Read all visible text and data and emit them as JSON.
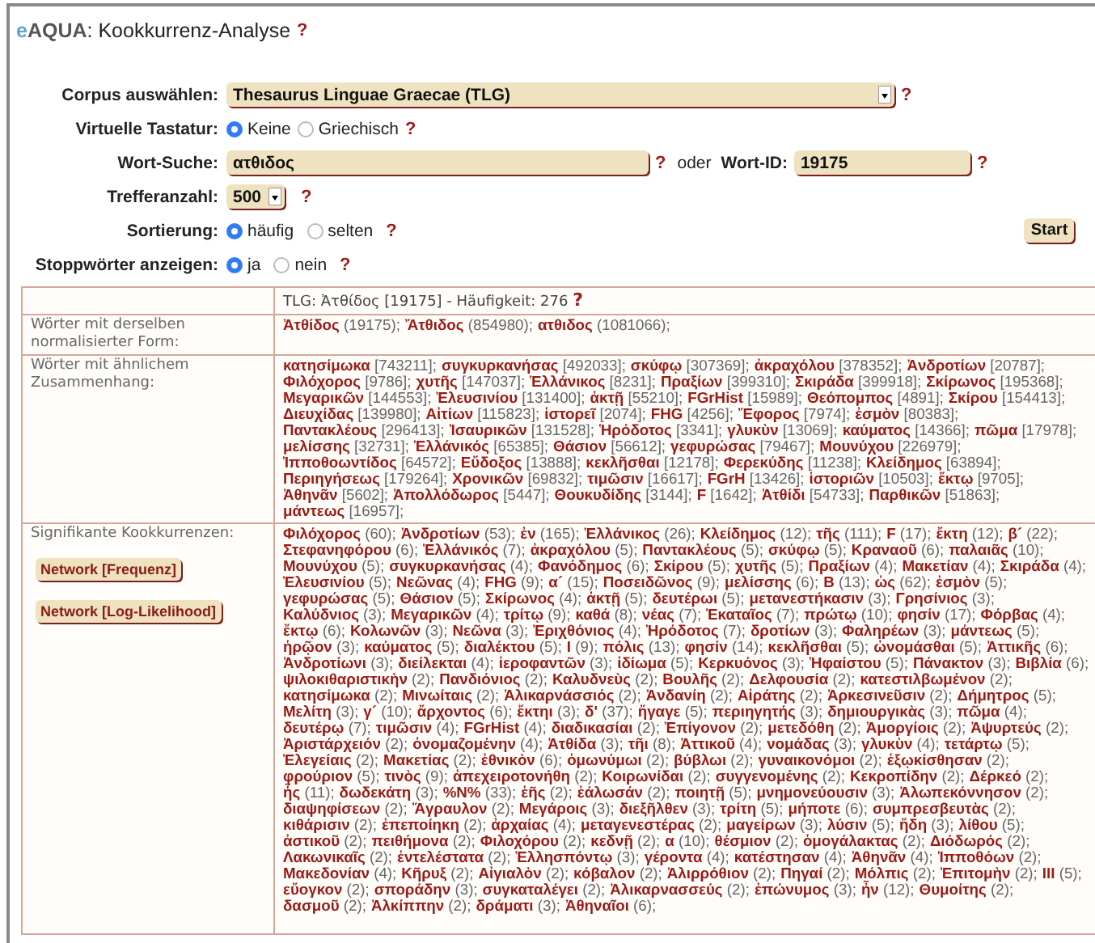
{
  "title": {
    "logo_e": "e",
    "logo_aqua": "AQUA",
    "text": ": Kookkurrenz-Analyse",
    "help": "?"
  },
  "form": {
    "corpus": {
      "label": "Corpus auswählen:",
      "value": "Thesaurus Linguae Graecae (TLG)",
      "help": "?"
    },
    "keyboard": {
      "label": "Virtuelle Tastatur:",
      "options": [
        {
          "label": "Keine",
          "selected": true
        },
        {
          "label": "Griechisch",
          "selected": false
        }
      ],
      "help": "?"
    },
    "search": {
      "label": "Wort-Suche:",
      "value": "ατθιδος",
      "help": "?",
      "or_text": "oder",
      "id_label": "Wort-ID:",
      "id_value": "19175",
      "id_help": "?"
    },
    "hits": {
      "label": "Trefferanzahl:",
      "value": "500",
      "help": "?"
    },
    "sort": {
      "label": "Sortierung:",
      "options": [
        {
          "label": "häufig",
          "selected": true
        },
        {
          "label": "selten",
          "selected": false
        }
      ],
      "help": "?"
    },
    "stopwords": {
      "label": "Stoppwörter anzeigen:",
      "options": [
        {
          "label": "ja",
          "selected": true
        },
        {
          "label": "nein",
          "selected": false
        }
      ],
      "help": "?"
    },
    "start_button": "Start"
  },
  "results": {
    "header": {
      "text": "TLG: Ἀτθίδος [19175] - Häufigkeit: 276",
      "help": "?"
    },
    "same_form": {
      "label": "Wörter mit derselben normalisierter Form:",
      "words": [
        {
          "word": "Ἀτθίδος",
          "count": "(19175);"
        },
        {
          "word": "Ἄτθιδος",
          "count": "(854980);"
        },
        {
          "word": "ατθιδος",
          "count": "(1081066);"
        }
      ]
    },
    "similar": {
      "label": "Wörter mit ähnlichem Zusammenhang:",
      "words": [
        {
          "word": "κατησίμωκα",
          "count": "[743211];"
        },
        {
          "word": "συγκυρκανήσας",
          "count": "[492033];"
        },
        {
          "word": "σκύφῳ",
          "count": "[307369];"
        },
        {
          "word": "ἀκραχόλου",
          "count": "[378352];"
        },
        {
          "word": "Ἀνδροτίων",
          "count": "[20787];"
        },
        {
          "word": "Φιλόχορος",
          "count": "[9786];"
        },
        {
          "word": "χυτῆς",
          "count": "[147037];"
        },
        {
          "word": "Ἑλλάνικος",
          "count": "[8231];"
        },
        {
          "word": "Πραξίων",
          "count": "[399310];"
        },
        {
          "word": "Σκιράδα",
          "count": "[399918];"
        },
        {
          "word": "Σκίρωνος",
          "count": "[195368];"
        },
        {
          "word": "Μεγαρικῶν",
          "count": "[144553];"
        },
        {
          "word": "Ἐλευσινίου",
          "count": "[131400];"
        },
        {
          "word": "ἀκτῇ",
          "count": "[55210];"
        },
        {
          "word": "FGrHist",
          "count": "[15989];"
        },
        {
          "word": "Θεόπομπος",
          "count": "[4891];"
        },
        {
          "word": "Σκίρου",
          "count": "[154413];"
        },
        {
          "word": "Διευχίδας",
          "count": "[139980];"
        },
        {
          "word": "Αἰτίων",
          "count": "[115823];"
        },
        {
          "word": "ἱστορεῖ",
          "count": "[2074];"
        },
        {
          "word": "FHG",
          "count": "[4256];"
        },
        {
          "word": "Ἔφορος",
          "count": "[7974];"
        },
        {
          "word": "ἐσμὸν",
          "count": "[80383];"
        },
        {
          "word": "Παντακλέους",
          "count": "[296413];"
        },
        {
          "word": "Ἰσαυρικῶν",
          "count": "[131528];"
        },
        {
          "word": "Ἡρόδοτος",
          "count": "[3341];"
        },
        {
          "word": "γλυκὺν",
          "count": "[13069];"
        },
        {
          "word": "καύματος",
          "count": "[14366];"
        },
        {
          "word": "πῶμα",
          "count": "[17978];"
        },
        {
          "word": "μελίσσης",
          "count": "[32731];"
        },
        {
          "word": "Ἑλλάνικός",
          "count": "[65385];"
        },
        {
          "word": "Θάσιον",
          "count": "[56612];"
        },
        {
          "word": "γεφυρώσας",
          "count": "[79467];"
        },
        {
          "word": "Μουνύχου",
          "count": "[226979];"
        },
        {
          "word": "Ἱπποθοωντίδος",
          "count": "[64572];"
        },
        {
          "word": "Εὔδοξος",
          "count": "[13888];"
        },
        {
          "word": "κεκλῆσθαι",
          "count": "[12178];"
        },
        {
          "word": "Φερεκύδης",
          "count": "[11238];"
        },
        {
          "word": "Κλείδημος",
          "count": "[63894];"
        },
        {
          "word": "Περιηγήσεως",
          "count": "[179264];"
        },
        {
          "word": "Χρονικῶν",
          "count": "[69832];"
        },
        {
          "word": "τιμῶσιν",
          "count": "[16617];"
        },
        {
          "word": "FGrH",
          "count": "[13426];"
        },
        {
          "word": "ἱστοριῶν",
          "count": "[10503];"
        },
        {
          "word": "ἔκτῳ",
          "count": "[9705];"
        },
        {
          "word": "Ἀθηνᾶν",
          "count": "[5602];"
        },
        {
          "word": "Ἀπολλόδωρος",
          "count": "[5447];"
        },
        {
          "word": "Θουκυδίδης",
          "count": "[3144];"
        },
        {
          "word": "F",
          "count": "[1642];"
        },
        {
          "word": "Ἀτθίδι",
          "count": "[54733];"
        },
        {
          "word": "Παρθικῶν",
          "count": "[51863];"
        },
        {
          "word": "μάντεως",
          "count": "[16957];"
        }
      ]
    },
    "cooccurrences": {
      "label": "Signifikante Kookkurrenzen:",
      "buttons": [
        "Network [Frequenz]",
        "Network [Log-Likelihood]"
      ],
      "words": [
        {
          "word": "Φιλόχορος",
          "count": "(60);"
        },
        {
          "word": "Ἀνδροτίων",
          "count": "(53);"
        },
        {
          "word": "ἐν",
          "count": "(165);"
        },
        {
          "word": "Ἑλλάνικος",
          "count": "(26);"
        },
        {
          "word": "Κλείδημος",
          "count": "(12);"
        },
        {
          "word": "τῆς",
          "count": "(111);"
        },
        {
          "word": "F",
          "count": "(17);"
        },
        {
          "word": "ἔκτη",
          "count": "(12);"
        },
        {
          "word": "β´",
          "count": "(22);"
        },
        {
          "word": "Στεφανηφόρου",
          "count": "(6);"
        },
        {
          "word": "Ἑλλάνικός",
          "count": "(7);"
        },
        {
          "word": "ἀκραχόλου",
          "count": "(5);"
        },
        {
          "word": "Παντακλέους",
          "count": "(5);"
        },
        {
          "word": "σκύφῳ",
          "count": "(5);"
        },
        {
          "word": "Κραναοῦ",
          "count": "(6);"
        },
        {
          "word": "παλαιᾶς",
          "count": "(10);"
        },
        {
          "word": "Μουνύχου",
          "count": "(5);"
        },
        {
          "word": "συγκυρκανήσας",
          "count": "(4);"
        },
        {
          "word": "Φανόδημος",
          "count": "(6);"
        },
        {
          "word": "Σκίρου",
          "count": "(5);"
        },
        {
          "word": "χυτῆς",
          "count": "(5);"
        },
        {
          "word": "Πραξίων",
          "count": "(4);"
        },
        {
          "word": "Μακετίαν",
          "count": "(4);"
        },
        {
          "word": "Σκιράδα",
          "count": "(4);"
        },
        {
          "word": "Ἐλευσινίου",
          "count": "(5);"
        },
        {
          "word": "Νεῶνας",
          "count": "(4);"
        },
        {
          "word": "FHG",
          "count": "(9);"
        },
        {
          "word": "α´",
          "count": "(15);"
        },
        {
          "word": "Ποσειδῶνος",
          "count": "(9);"
        },
        {
          "word": "μελίσσης",
          "count": "(6);"
        },
        {
          "word": "Β",
          "count": "(13);"
        },
        {
          "word": "ὡς",
          "count": "(62);"
        },
        {
          "word": "ἐσμὸν",
          "count": "(5);"
        },
        {
          "word": "γεφυρώσας",
          "count": "(5);"
        },
        {
          "word": "Θάσιον",
          "count": "(5);"
        },
        {
          "word": "Σκίρωνος",
          "count": "(4);"
        },
        {
          "word": "ἀκτῇ",
          "count": "(5);"
        },
        {
          "word": "δευτέρωι",
          "count": "(5);"
        },
        {
          "word": "μετανεστήκασιν",
          "count": "(3);"
        },
        {
          "word": "Γρησίνιος",
          "count": "(3);"
        },
        {
          "word": "Καλύδνιος",
          "count": "(3);"
        },
        {
          "word": "Μεγαρικῶν",
          "count": "(4);"
        },
        {
          "word": "τρίτῳ",
          "count": "(9);"
        },
        {
          "word": "καθά",
          "count": "(8);"
        },
        {
          "word": "νέας",
          "count": "(7);"
        },
        {
          "word": "Ἑκαταῖος",
          "count": "(7);"
        },
        {
          "word": "πρώτῳ",
          "count": "(10);"
        },
        {
          "word": "φησίν",
          "count": "(17);"
        },
        {
          "word": "Φόρβας",
          "count": "(4);"
        },
        {
          "word": "ἔκτῳ",
          "count": "(6);"
        },
        {
          "word": "Κολωνῶν",
          "count": "(3);"
        },
        {
          "word": "Νεῶνα",
          "count": "(3);"
        },
        {
          "word": "Ἐριχθόνιος",
          "count": "(4);"
        },
        {
          "word": "Ἡρόδοτος",
          "count": "(7);"
        },
        {
          "word": "δροτίων",
          "count": "(3);"
        },
        {
          "word": "Φαληρέων",
          "count": "(3);"
        },
        {
          "word": "μάντεως",
          "count": "(5);"
        },
        {
          "word": "ἡρῷον",
          "count": "(3);"
        },
        {
          "word": "καύματος",
          "count": "(5);"
        },
        {
          "word": "διαλέκτου",
          "count": "(5);"
        },
        {
          "word": "I",
          "count": "(9);"
        },
        {
          "word": "πόλις",
          "count": "(13);"
        },
        {
          "word": "φησίν",
          "count": "(14);"
        },
        {
          "word": "κεκλῆσθαι",
          "count": "(5);"
        },
        {
          "word": "ὠνομάσθαι",
          "count": "(5);"
        },
        {
          "word": "Ἀττικῆς",
          "count": "(6);"
        },
        {
          "word": "Ἀνδροτίωνι",
          "count": "(3);"
        },
        {
          "word": "διείλεκται",
          "count": "(4);"
        },
        {
          "word": "ἱεροφαντῶν",
          "count": "(3);"
        },
        {
          "word": "ἰδίωμα",
          "count": "(5);"
        },
        {
          "word": "Κερκυόνος",
          "count": "(3);"
        },
        {
          "word": "Ἡφαίστου",
          "count": "(5);"
        },
        {
          "word": "Πάνακτον",
          "count": "(3);"
        },
        {
          "word": "Βιβλία",
          "count": "(6);"
        },
        {
          "word": "ψιλοκιθαριστικὴν",
          "count": "(2);"
        },
        {
          "word": "Πανδιόνιος",
          "count": "(2);"
        },
        {
          "word": "Καλυδνεὺς",
          "count": "(2);"
        },
        {
          "word": "Βουλῆς",
          "count": "(2);"
        },
        {
          "word": "Δελφουσία",
          "count": "(2);"
        },
        {
          "word": "κατεστιλβωμένον",
          "count": "(2);"
        },
        {
          "word": "κατησίμωκα",
          "count": "(2);"
        },
        {
          "word": "Μινωίταις",
          "count": "(2);"
        },
        {
          "word": "Ἁλικαρνάσσιός",
          "count": "(2);"
        },
        {
          "word": "Ἀνδανίη",
          "count": "(2);"
        },
        {
          "word": "Αἰράτης",
          "count": "(2);"
        },
        {
          "word": "Ἀρκεσινεῦσιν",
          "count": "(2);"
        },
        {
          "word": "Δήμητρος",
          "count": "(5);"
        },
        {
          "word": "Μελίτη",
          "count": "(3);"
        },
        {
          "word": "γ´",
          "count": "(10);"
        },
        {
          "word": "ἄρχοντος",
          "count": "(6);"
        },
        {
          "word": "ἔκτηι",
          "count": "(3);"
        },
        {
          "word": "δ'",
          "count": "(37);"
        },
        {
          "word": "ἤγαγε",
          "count": "(5);"
        },
        {
          "word": "περιηγητής",
          "count": "(3);"
        },
        {
          "word": "δημιουργικὰς",
          "count": "(3);"
        },
        {
          "word": "πῶμα",
          "count": "(4);"
        },
        {
          "word": "δευτέρῳ",
          "count": "(7);"
        },
        {
          "word": "τιμῶσιν",
          "count": "(4);"
        },
        {
          "word": "FGrHist",
          "count": "(4);"
        },
        {
          "word": "διαδικασίαι",
          "count": "(2);"
        },
        {
          "word": "Ἐπίγονον",
          "count": "(2);"
        },
        {
          "word": "μετεδόθη",
          "count": "(2);"
        },
        {
          "word": "Ἀμοργίοις",
          "count": "(2);"
        },
        {
          "word": "Ἀψυρτεύς",
          "count": "(2);"
        },
        {
          "word": "Ἀριστάρχειόν",
          "count": "(2);"
        },
        {
          "word": "ὀνομαζομένην",
          "count": "(4);"
        },
        {
          "word": "Ἀτθίδα",
          "count": "(3);"
        },
        {
          "word": "τῆι",
          "count": "(8);"
        },
        {
          "word": "Ἀττικοῦ",
          "count": "(4);"
        },
        {
          "word": "νομάδας",
          "count": "(3);"
        },
        {
          "word": "γλυκὺν",
          "count": "(4);"
        },
        {
          "word": "τετάρτῳ",
          "count": "(5);"
        },
        {
          "word": "Ἐλεγείαις",
          "count": "(2);"
        },
        {
          "word": "Μακετίας",
          "count": "(2);"
        },
        {
          "word": "ἐθνικὸν",
          "count": "(6);"
        },
        {
          "word": "ὁμωνύμωι",
          "count": "(2);"
        },
        {
          "word": "βύβλωι",
          "count": "(2);"
        },
        {
          "word": "γυναικονόμοι",
          "count": "(2);"
        },
        {
          "word": "ἐξῳκίσθησαν",
          "count": "(2);"
        },
        {
          "word": "φρούριον",
          "count": "(5);"
        },
        {
          "word": "τινὸς",
          "count": "(9);"
        },
        {
          "word": "ἀπεχειροτονήθη",
          "count": "(2);"
        },
        {
          "word": "Κοιρωνίδαι",
          "count": "(2);"
        },
        {
          "word": "συγγενομένης",
          "count": "(2);"
        },
        {
          "word": "Κεκροπίδην",
          "count": "(2);"
        },
        {
          "word": "Δέρκεό",
          "count": "(2);"
        },
        {
          "word": "ἧς",
          "count": "(11);"
        },
        {
          "word": "δωδεκάτη",
          "count": "(3);"
        },
        {
          "word": "%Ν%",
          "count": "(33);"
        },
        {
          "word": "ἑῆς",
          "count": "(2);"
        },
        {
          "word": "ἑάλωσάν",
          "count": "(2);"
        },
        {
          "word": "ποιητῇ",
          "count": "(5);"
        },
        {
          "word": "μνημονεύουσιν",
          "count": "(3);"
        },
        {
          "word": "Ἀλωπεκόννησον",
          "count": "(2);"
        },
        {
          "word": "διαψηφίσεων",
          "count": "(2);"
        },
        {
          "word": "Ἄγραυλον",
          "count": "(2);"
        },
        {
          "word": "Μεγάροις",
          "count": "(3);"
        },
        {
          "word": "διεξῆλθεν",
          "count": "(3);"
        },
        {
          "word": "τρίτη",
          "count": "(5);"
        },
        {
          "word": "μήποτε",
          "count": "(6);"
        },
        {
          "word": "συμπρεσβευτὰς",
          "count": "(2);"
        },
        {
          "word": "κιθάρισιν",
          "count": "(2);"
        },
        {
          "word": "ἐπεποίηκη",
          "count": "(2);"
        },
        {
          "word": "ἀρχαίας",
          "count": "(4);"
        },
        {
          "word": "μεταγενεστέρας",
          "count": "(2);"
        },
        {
          "word": "μαγείρων",
          "count": "(3);"
        },
        {
          "word": "λύσιν",
          "count": "(5);"
        },
        {
          "word": "ἤδη",
          "count": "(3);"
        },
        {
          "word": "λίθου",
          "count": "(5);"
        },
        {
          "word": "ἀστικοῦ",
          "count": "(2);"
        },
        {
          "word": "πειθήμονα",
          "count": "(2);"
        },
        {
          "word": "Φιλοχόρου",
          "count": "(2);"
        },
        {
          "word": "κεδνῇ",
          "count": "(2);"
        },
        {
          "word": "α",
          "count": "(10);"
        },
        {
          "word": "θέσμιον",
          "count": "(2);"
        },
        {
          "word": "ὁμογάλακτας",
          "count": "(2);"
        },
        {
          "word": "Διόδωρός",
          "count": "(2);"
        },
        {
          "word": "Λακωνικαῖς",
          "count": "(2);"
        },
        {
          "word": "ἐντελέστατα",
          "count": "(2);"
        },
        {
          "word": "Ἑλλησπόντῳ",
          "count": "(3);"
        },
        {
          "word": "γέροντα",
          "count": "(4);"
        },
        {
          "word": "κατέστησαν",
          "count": "(4);"
        },
        {
          "word": "Ἀθηνᾶν",
          "count": "(4);"
        },
        {
          "word": "Ἱπποθόων",
          "count": "(2);"
        },
        {
          "word": "Μακεδονίαν",
          "count": "(4);"
        },
        {
          "word": "Κῆρυξ",
          "count": "(2);"
        },
        {
          "word": "Αἰγιαλὸν",
          "count": "(2);"
        },
        {
          "word": "κόβαλον",
          "count": "(2);"
        },
        {
          "word": "Ἀλιρρόθιον",
          "count": "(2);"
        },
        {
          "word": "Πηγαί",
          "count": "(2);"
        },
        {
          "word": "Μόλπις",
          "count": "(2);"
        },
        {
          "word": "Ἐπιτομὴν",
          "count": "(2);"
        },
        {
          "word": "III",
          "count": "(5);"
        },
        {
          "word": "εὔογκον",
          "count": "(2);"
        },
        {
          "word": "σποράδην",
          "count": "(3);"
        },
        {
          "word": "συγκαταλέγει",
          "count": "(2);"
        },
        {
          "word": "Ἀλικαρνασσεύς",
          "count": "(2);"
        },
        {
          "word": "ἐπώνυμος",
          "count": "(3);"
        },
        {
          "word": "ἦν",
          "count": "(12);"
        },
        {
          "word": "Θυμοίτης",
          "count": "(2);"
        },
        {
          "word": "δασμοῦ",
          "count": "(2);"
        },
        {
          "word": "Ἀλκίππην",
          "count": "(2);"
        },
        {
          "word": "δράματι",
          "count": "(3);"
        },
        {
          "word": "Ἀθηναῖοι",
          "count": "(6);"
        }
      ]
    }
  }
}
